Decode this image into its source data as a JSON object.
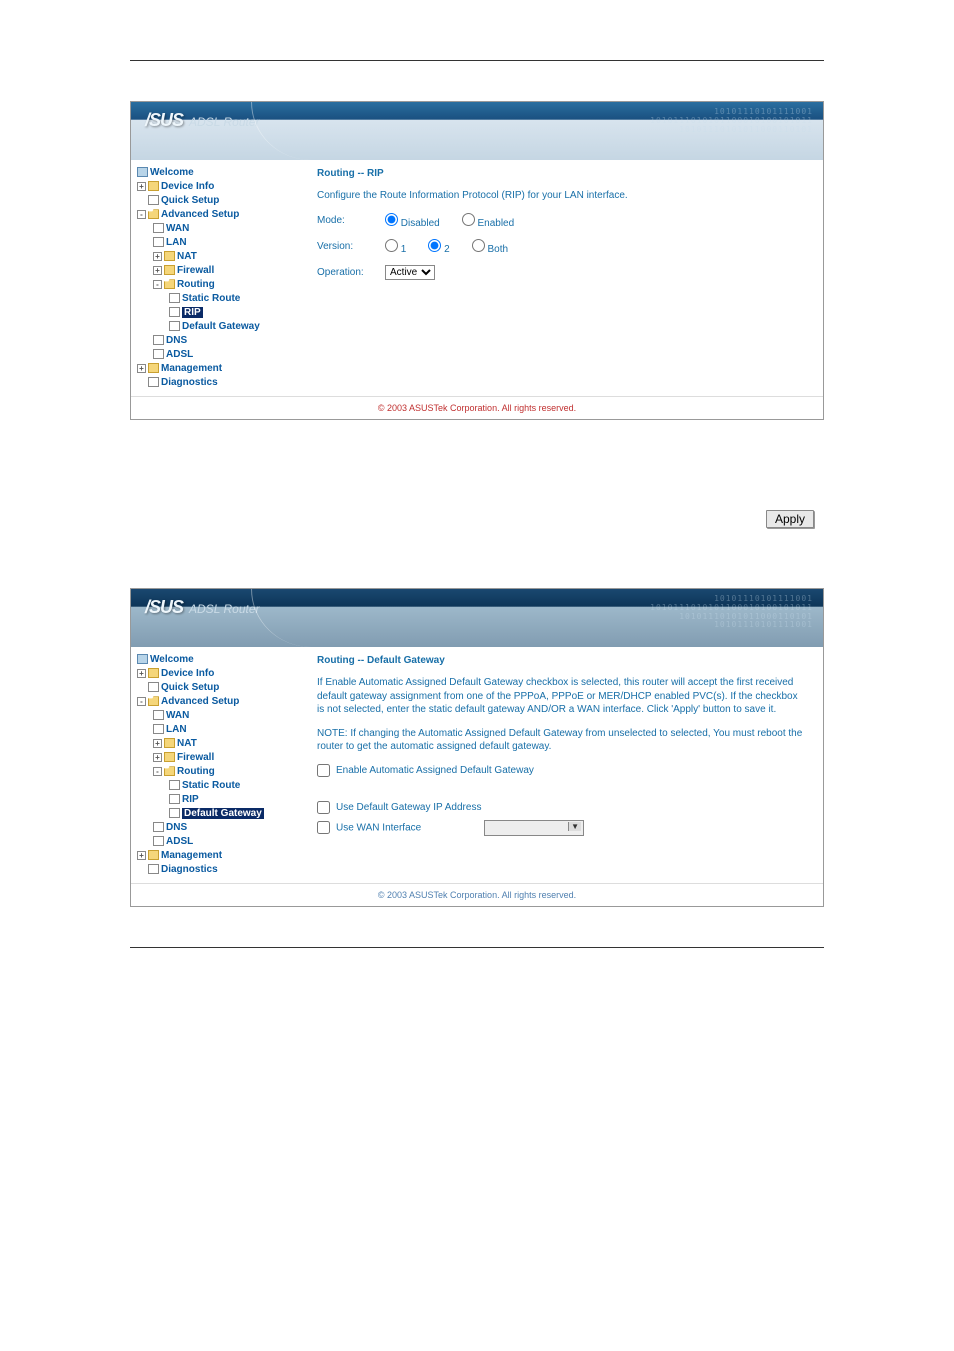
{
  "banner": {
    "logo": "/SUS",
    "product": "ADSL Router",
    "binary1": "10101110101111001",
    "binary2": "1010111010101100010100101011",
    "binary3": "10101110101011000110101"
  },
  "tree": {
    "welcome": "Welcome",
    "device_info": "Device Info",
    "quick_setup": "Quick Setup",
    "advanced_setup": "Advanced Setup",
    "wan": "WAN",
    "lan": "LAN",
    "nat": "NAT",
    "firewall": "Firewall",
    "routing": "Routing",
    "static_route": "Static Route",
    "rip": "RIP",
    "default_gateway": "Default Gateway",
    "dns": "DNS",
    "adsl": "ADSL",
    "management": "Management",
    "diagnostics": "Diagnostics"
  },
  "rip": {
    "title": "Routing -- RIP",
    "desc": "Configure the Route Information Protocol (RIP) for your LAN interface.",
    "mode_label": "Mode:",
    "mode_disabled": "Disabled",
    "mode_enabled": "Enabled",
    "version_label": "Version:",
    "v1": "1",
    "v2": "2",
    "both": "Both",
    "operation_label": "Operation:",
    "operation_value": "Active"
  },
  "apply_label": "Apply",
  "dg": {
    "title": "Routing -- Default Gateway",
    "para1": "If Enable Automatic Assigned Default Gateway checkbox is selected, this router will accept the first received default gateway assignment from one of the PPPoA, PPPoE or MER/DHCP enabled PVC(s). If the checkbox is not selected, enter the static default gateway AND/OR a WAN interface. Click 'Apply' button to save it.",
    "para2": "NOTE: If changing the Automatic Assigned Default Gateway from unselected to selected, You must reboot the router to get the automatic assigned default gateway.",
    "chk_auto": "Enable Automatic Assigned Default Gateway",
    "chk_ip": "Use Default Gateway IP Address",
    "chk_wan": "Use WAN Interface"
  },
  "footer": "© 2003 ASUSTek Corporation. All rights reserved."
}
